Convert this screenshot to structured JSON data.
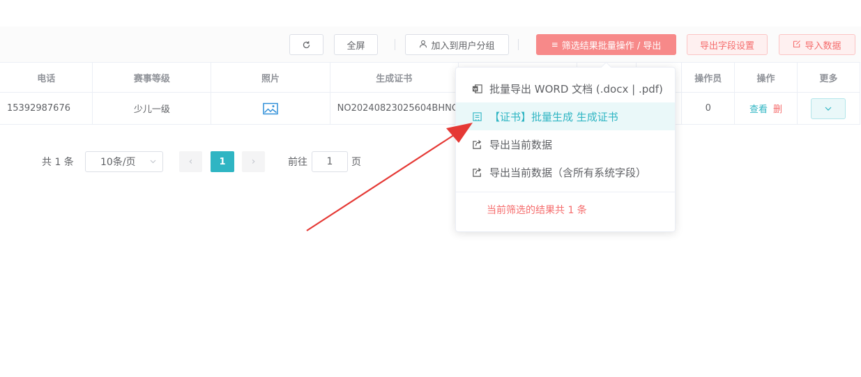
{
  "toolbar": {
    "refresh_icon": "refresh-icon",
    "fullscreen_label": "全屏",
    "add_group_label": "加入到用户分组",
    "batch_label": "筛选结果批量操作 / 导出",
    "export_fields_label": "导出字段设置",
    "import_label": "导入数据"
  },
  "table": {
    "columns": [
      "电话",
      "赛事等级",
      "照片",
      "生成证书",
      "操作员",
      "操作",
      "更多"
    ],
    "row": {
      "phone": "15392987676",
      "level": "少儿一级",
      "photo_icon": "image-icon",
      "certificate": "NO20240823025604BHNC",
      "operator": "0",
      "action_view": "查看",
      "action_delete": "删"
    }
  },
  "pagination": {
    "total": "共 1 条",
    "page_size": "10条/页",
    "current": "1",
    "goto_label": "前往",
    "goto_value": "1",
    "goto_unit": "页"
  },
  "dropdown": {
    "items": [
      {
        "label": "批量导出 WORD 文档 (.docx | .pdf)",
        "icon": "word-icon"
      },
      {
        "label": "【证书】批量生成 生成证书",
        "icon": "certificate-icon"
      },
      {
        "label": "导出当前数据",
        "icon": "export-icon"
      },
      {
        "label": "导出当前数据（含所有系统字段）",
        "icon": "export-icon"
      }
    ],
    "footer": "当前筛选的结果共 1 条"
  },
  "colors": {
    "accent": "#2fb5c3",
    "danger": "#f56c6c",
    "arrow": "#e53935"
  }
}
